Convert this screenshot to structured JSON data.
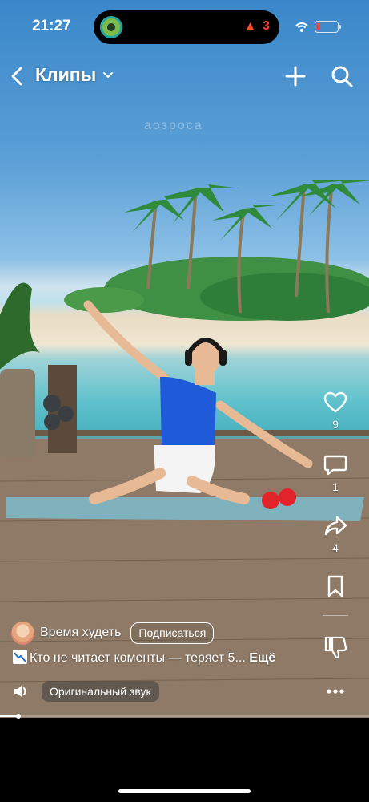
{
  "status_bar": {
    "time": "21:27",
    "streak_count": "3",
    "streak_color": "#ff3b30"
  },
  "header": {
    "title": "Клипы"
  },
  "video": {
    "watermark": "аозроса",
    "progress": 0.05
  },
  "actions": {
    "likes": "9",
    "comments": "1",
    "shares": "4"
  },
  "author": {
    "name": "Время худеть",
    "subscribe_label": "Подписаться"
  },
  "caption": {
    "text": "Кто не читает коменты — теряет 5...",
    "more_label": "Ещё"
  },
  "sound": {
    "label": "Оригинальный звук"
  },
  "icons": [
    "back-chevron-icon",
    "chevron-down-icon",
    "plus-icon",
    "search-icon",
    "heart-icon",
    "comment-icon",
    "share-icon",
    "bookmark-icon",
    "dislike-icon",
    "speaker-icon",
    "more-dots-icon",
    "wifi-icon",
    "battery-icon",
    "flame-icon"
  ]
}
